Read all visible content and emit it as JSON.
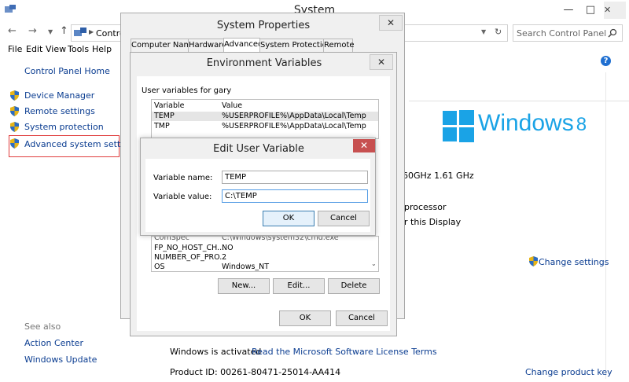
{
  "system_window": {
    "title": "System",
    "address_text": "Contro",
    "search_placeholder": "Search Control Panel"
  },
  "menubar": [
    "File",
    "Edit",
    "View",
    "Tools",
    "Help"
  ],
  "sidebar": {
    "home": "Control Panel Home",
    "items": [
      "Device Manager",
      "Remote settings",
      "System protection",
      "Advanced system settings"
    ],
    "see_also_heading": "See also",
    "see_also": [
      "Action Center",
      "Windows Update"
    ]
  },
  "main": {
    "logo_text": "Windows",
    "logo_version": "8",
    "cpu_fragment": "60GHz   1.61 GHz",
    "processor_fragment": "processor",
    "display_fragment": "r this Display",
    "change_settings": "Change settings",
    "activated_text": "Windows is activated",
    "license_link": "Read the Microsoft Software License Terms",
    "product_id": "Product ID: 00261-80471-25014-AA414",
    "change_key": "Change product key"
  },
  "system_properties": {
    "title": "System Properties",
    "tabs": [
      "Computer Name",
      "Hardware",
      "Advanced",
      "System Protection",
      "Remote"
    ],
    "active_tab": "Advanced"
  },
  "env_vars": {
    "title": "Environment Variables",
    "user_label": "User variables for gary",
    "columns": [
      "Variable",
      "Value"
    ],
    "user_rows": [
      {
        "variable": "TEMP",
        "value": "%USERPROFILE%\\AppData\\Local\\Temp"
      },
      {
        "variable": "TMP",
        "value": "%USERPROFILE%\\AppData\\Local\\Temp"
      }
    ],
    "system_rows": [
      {
        "variable": "ComSpec",
        "value": "C:\\Windows\\system32\\cmd.exe"
      },
      {
        "variable": "FP_NO_HOST_CH...",
        "value": "NO"
      },
      {
        "variable": "NUMBER_OF_PRO...",
        "value": "2"
      },
      {
        "variable": "OS",
        "value": "Windows_NT"
      }
    ],
    "buttons": {
      "new": "New...",
      "edit": "Edit...",
      "delete": "Delete"
    },
    "ok": "OK",
    "cancel": "Cancel"
  },
  "edit_user_variable": {
    "title": "Edit User Variable",
    "name_label": "Variable name:",
    "name_value": "TEMP",
    "value_label": "Variable value:",
    "value_value": "C:\\TEMP",
    "ok": "OK",
    "cancel": "Cancel"
  },
  "colors": {
    "accent_blue": "#1aa3e6",
    "link_blue": "#0b3d91",
    "close_red": "#c75050",
    "highlight_red": "#e03c3c"
  }
}
